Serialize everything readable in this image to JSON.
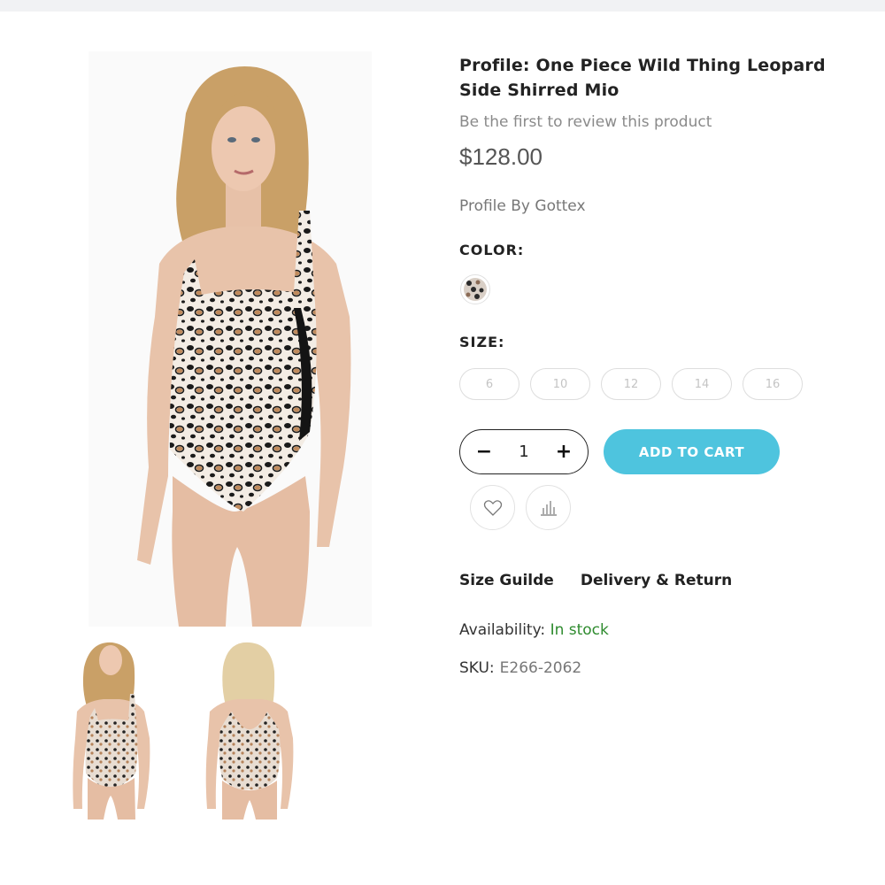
{
  "product": {
    "title": "Profile: One Piece Wild Thing Leopard Side Shirred Mio",
    "review_link": "Be the first to review this product",
    "price": "$128.00",
    "brand": "Profile By Gottex"
  },
  "color": {
    "label": "COLOR:",
    "selected": "leopard"
  },
  "size": {
    "label": "SIZE:",
    "options": [
      "6",
      "10",
      "12",
      "14",
      "16"
    ]
  },
  "cart": {
    "qty_minus": "−",
    "quantity": "1",
    "qty_plus": "+",
    "add_label": "ADD TO CART"
  },
  "actions": {
    "wishlist_icon": "heart-icon",
    "compare_icon": "compare-icon"
  },
  "links": {
    "size_guide": "Size Guilde",
    "delivery": "Delivery & Return"
  },
  "meta": {
    "availability_label": "Availability:",
    "availability_value": "In stock",
    "sku_label": "SKU:",
    "sku_value": "E266-2062"
  },
  "colors": {
    "accent": "#4ec4de",
    "in_stock": "#2e8b2e"
  }
}
